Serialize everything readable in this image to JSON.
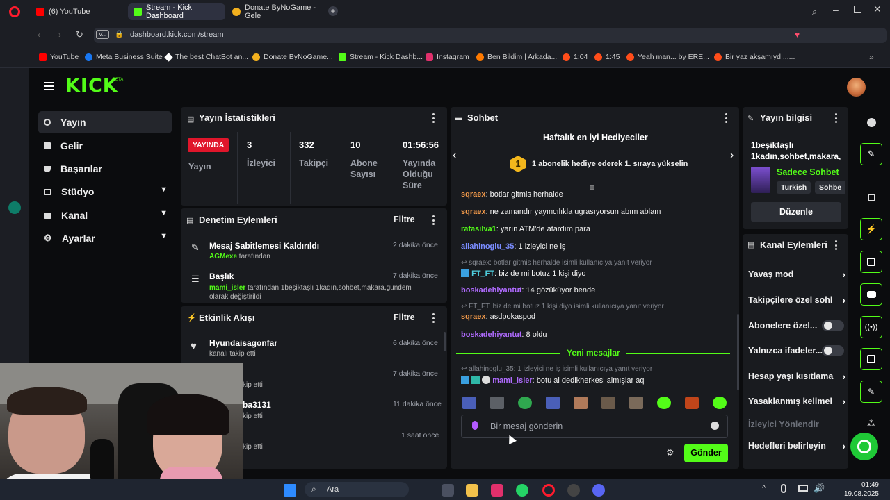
{
  "browser": {
    "tabs": [
      {
        "label": "(6) YouTube",
        "color": "#ff0000"
      },
      {
        "label": "Stream - Kick Dashboard",
        "color": "#53fc18"
      },
      {
        "label": "Donate ByNoGame - Gele",
        "color": "#f2b01e"
      }
    ],
    "address": "dashboard.kick.com/stream",
    "address_prefix": "V...",
    "bookmarks": [
      {
        "label": "YouTube",
        "color": "#ff0000"
      },
      {
        "label": "Meta Business Suite",
        "color": "#1877f2"
      },
      {
        "label": "The best ChatBot an...",
        "color": "#ffffff"
      },
      {
        "label": "Donate ByNoGame...",
        "color": "#f2b01e"
      },
      {
        "label": "Stream - Kick Dashb...",
        "color": "#53fc18"
      },
      {
        "label": "Instagram",
        "color": "#e1306c"
      },
      {
        "label": "Ben Bildim | Arkada...",
        "color": "#ff7a00"
      },
      {
        "label": "1:04",
        "color": "#ff4d1a"
      },
      {
        "label": "1:45",
        "color": "#ff4d1a"
      },
      {
        "label": "Yeah man... by ERE...",
        "color": "#ff4d1a"
      },
      {
        "label": "Bir yaz akşamıydı......",
        "color": "#ff4d1a"
      }
    ]
  },
  "kick": {
    "logo_text": "KICK",
    "logo_badge": "BETA",
    "accent": "#53fc18"
  },
  "sidebar": {
    "items": [
      {
        "label": "Yayın",
        "icon": "broadcast-icon"
      },
      {
        "label": "Gelir",
        "icon": "revenue-icon"
      },
      {
        "label": "Başarılar",
        "icon": "trophy-icon"
      },
      {
        "label": "Stüdyo",
        "icon": "studio-icon"
      },
      {
        "label": "Kanal",
        "icon": "channel-icon"
      },
      {
        "label": "Ayarlar",
        "icon": "settings-icon"
      }
    ]
  },
  "stats": {
    "title": "Yayın İstatistikleri",
    "live_badge": "YAYINDA",
    "live_label": "Yayın",
    "viewers": "3",
    "viewers_label": "İzleyici",
    "followers": "332",
    "followers_label": "Takipçi",
    "subs": "10",
    "subs_label": "Abone Sayısı",
    "uptime": "01:56:56",
    "uptime_label": "Yayında Olduğu Süre"
  },
  "moderation": {
    "title": "Denetim Eylemleri",
    "filter": "Filtre",
    "items": [
      {
        "title": "Mesaj Sabitlemesi Kaldırıldı",
        "user": "AGMexe",
        "suffix": "tarafından",
        "time": "2 dakika önce"
      },
      {
        "title": "Başlık",
        "user": "mami_isler",
        "suffix": "tarafından 1beşiktaşlı 1kadın,sohbet,makara,gündem olarak değiştirildi",
        "time": "7 dakika önce"
      }
    ]
  },
  "activity": {
    "title": "Etkinlik Akışı",
    "filter": "Filtre",
    "items": [
      {
        "name": "Hyundaisagonfar",
        "detail": "kanalı takip etti",
        "time": "6 dakika önce"
      },
      {
        "name": "",
        "detail": "kip etti",
        "time": "7 dakika önce"
      },
      {
        "name": "ba3131",
        "detail": "kip etti",
        "time": "11 dakika önce"
      },
      {
        "name": "",
        "detail": "kip etti",
        "time": "1 saat önce"
      }
    ]
  },
  "chat": {
    "title": "Sohbet",
    "gifters_title": "Haftalık en iyi Hediyeciler",
    "gifters_rank": "1",
    "gifters_text": "1 abonelik hediye ederek 1. sıraya yükselin",
    "new_messages": "Yeni mesajlar",
    "input_placeholder": "Bir mesaj gönderin",
    "send": "Gönder",
    "messages": [
      {
        "user": "sqraex",
        "color": "#f39a4a",
        "text": "botlar gitmis herhalde",
        "reply": ""
      },
      {
        "user": "sqraex",
        "color": "#f39a4a",
        "text": "ne zamandır yayıncılıkla ugrasıyorsun abım ablam",
        "reply": ""
      },
      {
        "user": "rafasilva1",
        "color": "#53fc18",
        "text": "yarın ATM'de atardım para",
        "reply": ""
      },
      {
        "user": "allahinoglu_35",
        "color": "#7a8cff",
        "text": "1 izleyici ne iş",
        "reply": ""
      },
      {
        "user": "FT_FT",
        "color": "#4fd0e0",
        "text": "biz de mi botuz 1 kişi diyo",
        "reply": "sqraex: botlar gitmis herhalde isimli kullanıcıya yanıt veriyor"
      },
      {
        "user": "boskadehiyantut",
        "color": "#b06bff",
        "text": "14 gözüküyor bende",
        "reply": ""
      },
      {
        "user": "sqraex",
        "color": "#f39a4a",
        "text": "asdpokaspod",
        "reply": "FT_FT: biz de mi botuz 1 kişi diyo isimli kullanıcıya yanıt veriyor"
      },
      {
        "user": "boskadehiyantut",
        "color": "#b06bff",
        "text": "8 oldu",
        "reply": ""
      },
      {
        "user": "mami_isler",
        "color": "#b06bff",
        "text": "botu al dedikherkesi almışlar aq",
        "reply": "allahinoglu_35: 1 izleyici ne iş isimli kullanıcıya yanıt veriyor"
      }
    ]
  },
  "stream_info": {
    "title": "Yayın bilgisi",
    "stream_title": "1beşiktaşlı 1kadın,sohbet,makara,",
    "category": "Sadece Sohbet",
    "tags": [
      "Turkish",
      "Sohbe"
    ],
    "edit": "Düzenle"
  },
  "channel_actions": {
    "title": "Kanal Eylemleri",
    "items": [
      {
        "label": "Yavaş mod",
        "type": "chevron"
      },
      {
        "label": "Takipçilere özel sohl",
        "type": "chevron"
      },
      {
        "label": "Abonelere özel...",
        "type": "toggle"
      },
      {
        "label": "Yalnızca ifadeler...",
        "type": "toggle"
      },
      {
        "label": "Hesap yaşı kısıtlama",
        "type": "chevron"
      },
      {
        "label": "Yasaklanmış kelimel",
        "type": "chevron"
      },
      {
        "label": "İzleyici Yönlendir",
        "type": "disabled"
      },
      {
        "label": "Hedefleri belirleyin",
        "type": "chevron"
      }
    ]
  },
  "taskbar": {
    "search": "Ara",
    "time": "01:49",
    "date": "19.08.2025"
  }
}
